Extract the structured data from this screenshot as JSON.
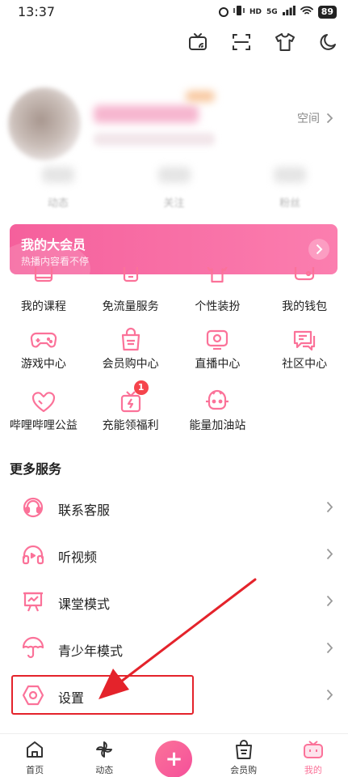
{
  "status_bar": {
    "time": "13:37",
    "network_tag": "HD",
    "signal_tag": "5G",
    "battery": "89"
  },
  "top_toolbar": {
    "icons": [
      "tv-icon",
      "scan-icon",
      "tshirt-icon",
      "moon-icon"
    ]
  },
  "profile": {
    "space_label": "空间",
    "stats": [
      "动态",
      "关注",
      "粉丝"
    ]
  },
  "vip_banner": {
    "title": "我的大会员",
    "subtitle": "热播内容看不停"
  },
  "grid": {
    "rows": [
      [
        {
          "label": "我的课程",
          "icon": "course-icon"
        },
        {
          "label": "免流量服务",
          "icon": "data-free-icon"
        },
        {
          "label": "个性装扮",
          "icon": "tshirt-icon"
        },
        {
          "label": "我的钱包",
          "icon": "wallet-icon"
        }
      ],
      [
        {
          "label": "游戏中心",
          "icon": "gamepad-icon"
        },
        {
          "label": "会员购中心",
          "icon": "shopping-bag-icon"
        },
        {
          "label": "直播中心",
          "icon": "live-icon"
        },
        {
          "label": "社区中心",
          "icon": "chat-icon"
        }
      ],
      [
        {
          "label": "哔哩哔哩公益",
          "icon": "heart-icon"
        },
        {
          "label": "充能领福利",
          "icon": "gift-icon",
          "badge": "1"
        },
        {
          "label": "能量加油站",
          "icon": "energy-icon"
        }
      ]
    ]
  },
  "more_services": {
    "title": "更多服务",
    "items": [
      {
        "label": "联系客服",
        "icon": "headset-icon"
      },
      {
        "label": "听视频",
        "icon": "headphones-icon"
      },
      {
        "label": "课堂模式",
        "icon": "classroom-icon"
      },
      {
        "label": "青少年模式",
        "icon": "umbrella-icon"
      },
      {
        "label": "设置",
        "icon": "settings-icon"
      }
    ]
  },
  "bottom_nav": {
    "items": [
      {
        "label": "首页",
        "icon": "home-icon"
      },
      {
        "label": "动态",
        "icon": "pinwheel-icon"
      },
      {
        "label": "",
        "icon": "plus-icon"
      },
      {
        "label": "会员购",
        "icon": "shopping-bag-icon"
      },
      {
        "label": "我的",
        "icon": "tv-icon",
        "active": true
      }
    ]
  },
  "colors": {
    "accent": "#fb7299",
    "vip_start": "#f5609c",
    "vip_end": "#fb7eaf",
    "annotation": "#e4232b"
  }
}
